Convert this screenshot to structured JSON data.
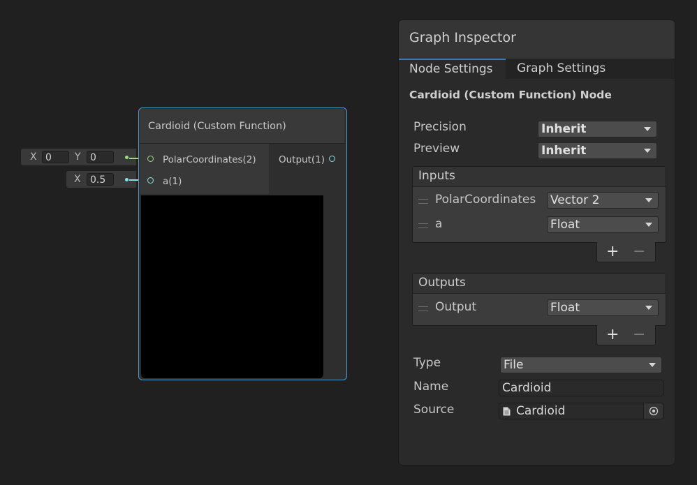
{
  "colors": {
    "background": "#202020",
    "node_outline": "#4c9ac8",
    "vector2_port": "#9dd980",
    "float_port": "#84e4e7",
    "tab_active": "#3a79bb"
  },
  "ports_defaults": {
    "polar": {
      "x_label": "X",
      "x_value": "0",
      "y_label": "Y",
      "y_value": "0"
    },
    "a": {
      "x_label": "X",
      "x_value": "0.5"
    }
  },
  "node": {
    "title": "Cardioid (Custom Function)",
    "inputs": [
      {
        "label": "PolarCoordinates(2)",
        "type": "vector2"
      },
      {
        "label": "a(1)",
        "type": "float"
      }
    ],
    "outputs": [
      {
        "label": "Output(1)",
        "type": "float"
      }
    ]
  },
  "inspector": {
    "title": "Graph Inspector",
    "tabs": [
      "Node Settings",
      "Graph Settings"
    ],
    "active_tab": "Node Settings",
    "node_heading": "Cardioid (Custom Function) Node",
    "precision": {
      "label": "Precision",
      "value": "Inherit"
    },
    "preview": {
      "label": "Preview",
      "value": "Inherit"
    },
    "inputs": {
      "header": "Inputs",
      "items": [
        {
          "name": "PolarCoordinates",
          "type": "Vector 2"
        },
        {
          "name": "a",
          "type": "Float"
        }
      ],
      "add": "+",
      "remove": "−"
    },
    "outputs": {
      "header": "Outputs",
      "items": [
        {
          "name": "Output",
          "type": "Float"
        }
      ],
      "add": "+",
      "remove": "−"
    },
    "type": {
      "label": "Type",
      "value": "File"
    },
    "name": {
      "label": "Name",
      "value": "Cardioid"
    },
    "source": {
      "label": "Source",
      "value": "Cardioid",
      "icon": "file-icon",
      "picker_icon": "object-picker-icon"
    }
  }
}
